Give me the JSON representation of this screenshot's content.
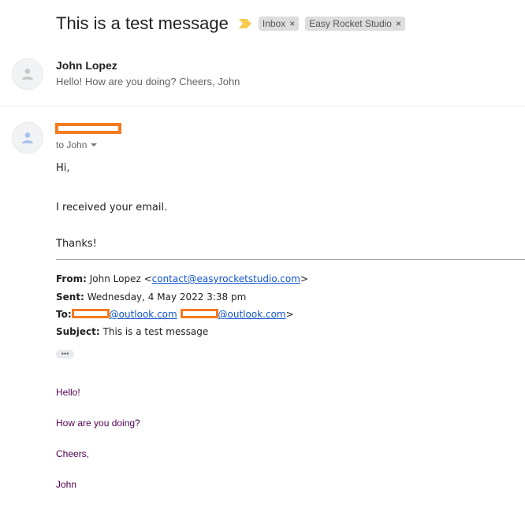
{
  "thread": {
    "subject": "This is a test message",
    "importance_icon": "importance-marker-icon",
    "labels": [
      {
        "name": "Inbox",
        "remove": "×"
      },
      {
        "name": "Easy Rocket Studio",
        "remove": "×"
      }
    ]
  },
  "colors": {
    "importance": "#f7cb4d",
    "redaction": "#f47b20",
    "link": "#1155cc",
    "quoted_text": "#500050"
  },
  "collapsed_message": {
    "sender": "John Lopez",
    "snippet": "Hello! How are you doing? Cheers, John",
    "avatar_icon": "person-icon"
  },
  "open_message": {
    "sender": "[redacted]",
    "to_label": "to John",
    "avatar_icon": "person-icon",
    "body": [
      "Hi,",
      "I received your email.",
      "Thanks!"
    ],
    "quoted_header": {
      "from_label": "From:",
      "from_name": "John Lopez <",
      "from_email": "contact@easyrocketstudio.com",
      "from_close": ">",
      "sent_label": "Sent:",
      "sent_value": "Wednesday, 4 May 2022 3:38 pm",
      "to_label": "To:",
      "to_email_1_domain": "@outlook.com",
      "to_sep": " ",
      "to_email_2_domain": "@outlook.com",
      "to_close": ">",
      "subject_label": "Subject:",
      "subject_value": "This is a test message"
    },
    "show_trimmed": "•••",
    "quoted_body": [
      "Hello!",
      "How are you doing?",
      "Cheers,",
      "John"
    ]
  }
}
